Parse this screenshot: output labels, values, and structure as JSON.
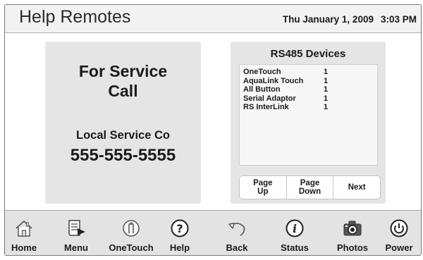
{
  "header": {
    "title": "Help Remotes",
    "date": "Thu January 1, 2009",
    "time": "3:03 PM"
  },
  "service": {
    "heading": "For Service\nCall",
    "company": "Local Service Co",
    "phone": "555-555-5555"
  },
  "devices": {
    "title": "RS485 Devices",
    "items": [
      {
        "name": "OneTouch",
        "count": "1"
      },
      {
        "name": "AquaLink Touch",
        "count": "1"
      },
      {
        "name": "All Button",
        "count": "1"
      },
      {
        "name": "Serial Adaptor",
        "count": "1"
      },
      {
        "name": "RS InterLink",
        "count": "1"
      }
    ],
    "buttons": {
      "page_up": "Page\nUp",
      "page_down": "Page\nDown",
      "next": "Next"
    }
  },
  "nav": {
    "home": "Home",
    "menu": "Menu",
    "onetouch": "OneTouch",
    "help": "Help",
    "back": "Back",
    "status": "Status",
    "photos": "Photos",
    "power": "Power"
  },
  "icons": {
    "home": "house-icon",
    "menu": "document-icon",
    "onetouch": "finger-icon",
    "help": "question-icon",
    "back": "back-arrow-icon",
    "status": "info-icon",
    "photos": "camera-icon",
    "power": "power-icon"
  }
}
